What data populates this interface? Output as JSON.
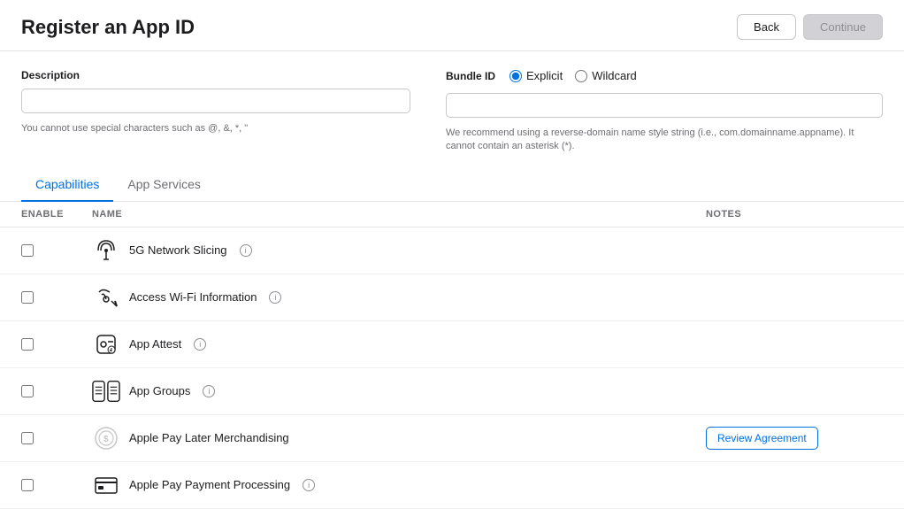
{
  "header": {
    "title": "Register an App ID",
    "back_label": "Back",
    "continue_label": "Continue"
  },
  "form": {
    "description": {
      "label": "Description",
      "placeholder": "",
      "hint": "You cannot use special characters such as @, &, *, \""
    },
    "bundle_id": {
      "label": "Bundle ID",
      "explicit_label": "Explicit",
      "wildcard_label": "Wildcard",
      "placeholder": "",
      "hint": "We recommend using a reverse-domain name style string (i.e., com.domainname.appname). It cannot contain an asterisk (*)."
    }
  },
  "tabs": [
    {
      "id": "capabilities",
      "label": "Capabilities",
      "active": true
    },
    {
      "id": "app-services",
      "label": "App Services",
      "active": false
    }
  ],
  "table": {
    "columns": [
      {
        "id": "enable",
        "label": "ENABLE"
      },
      {
        "id": "name",
        "label": "NAME"
      },
      {
        "id": "notes",
        "label": "NOTES"
      }
    ],
    "rows": [
      {
        "id": "5g-network-slicing",
        "enabled": false,
        "icon": "5g-icon",
        "name": "5G Network Slicing",
        "has_info": true,
        "notes": null,
        "review_label": null
      },
      {
        "id": "access-wifi-information",
        "enabled": false,
        "icon": "wifi-icon",
        "name": "Access Wi-Fi Information",
        "has_info": true,
        "notes": null,
        "review_label": null
      },
      {
        "id": "app-attest",
        "enabled": false,
        "icon": "attest-icon",
        "name": "App Attest",
        "has_info": true,
        "notes": null,
        "review_label": null
      },
      {
        "id": "app-groups",
        "enabled": false,
        "icon": "groups-icon",
        "name": "App Groups",
        "has_info": true,
        "notes": null,
        "review_label": null
      },
      {
        "id": "apple-pay-later",
        "enabled": false,
        "icon": "pay-later-icon",
        "name": "Apple Pay Later Merchandising",
        "has_info": false,
        "notes": null,
        "review_label": "Review Agreement"
      },
      {
        "id": "apple-pay-payment",
        "enabled": false,
        "icon": "pay-process-icon",
        "name": "Apple Pay Payment Processing",
        "has_info": true,
        "notes": null,
        "review_label": null
      }
    ]
  }
}
